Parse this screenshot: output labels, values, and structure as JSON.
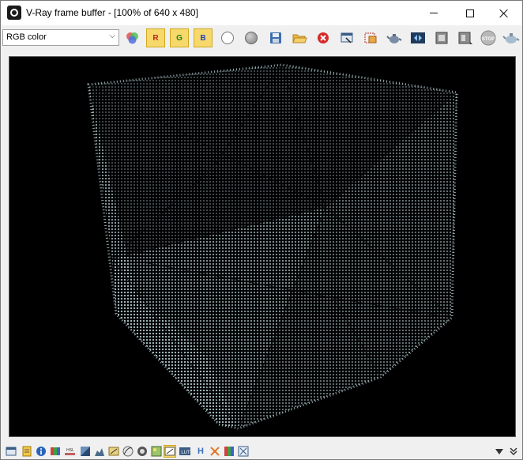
{
  "window": {
    "title": "V-Ray frame buffer - [100% of 640 x 480]"
  },
  "toolbar": {
    "channel": "RGB color",
    "red_label": "R",
    "green_label": "G",
    "blue_label": "B",
    "stop_label": "STOP"
  },
  "colors": {
    "toggle_fill": "#f7d96b",
    "render_bg": "#000000",
    "cube_dots": "#bcd6db",
    "clear_red": "#d42a2a"
  },
  "statusbar": {
    "hist_label": "HSL",
    "lut_label": "LUT",
    "h_label": "H",
    "ocio_label": "OCIO"
  },
  "icons": [
    "app-vray-icon",
    "minimize-icon",
    "maximize-icon",
    "close-icon",
    "channel-dropdown-chevron-icon",
    "color-channels-icon",
    "red-channel-icon",
    "green-channel-icon",
    "blue-channel-icon",
    "white-circle-icon",
    "gray-circle-icon",
    "save-icon",
    "open-icon",
    "clear-icon",
    "copy-to-window-icon",
    "region-render-icon",
    "teapot-render-icon",
    "lens-effects-icon",
    "history-icon",
    "compare-icon",
    "stop-icon",
    "render-teapot-icon"
  ]
}
